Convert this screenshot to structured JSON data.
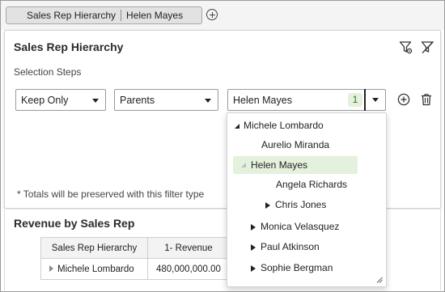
{
  "chip": {
    "hierarchy": "Sales Rep Hierarchy",
    "member": "Helen Mayes"
  },
  "panel": {
    "title": "Sales Rep Hierarchy",
    "steps_label": "Selection Steps",
    "action": "Keep Only",
    "relation": "Parents",
    "member": "Helen Mayes",
    "member_count": "1",
    "note": "* Totals will be preserved with this filter type"
  },
  "report": {
    "title": "Revenue by Sales Rep",
    "columns": [
      "Sales Rep Hierarchy",
      "1- Revenue"
    ],
    "rows": [
      {
        "rep": "Michele Lombardo",
        "revenue": "480,000,000.00"
      }
    ]
  },
  "tree": [
    {
      "label": "Michele Lombardo",
      "level": 0,
      "toggle": "expanded"
    },
    {
      "label": "Aurelio Miranda",
      "level": 1,
      "toggle": "none"
    },
    {
      "label": "Helen Mayes",
      "level": 1,
      "toggle": "expanded-light",
      "selected": true
    },
    {
      "label": "Angela Richards",
      "level": 2,
      "toggle": "none"
    },
    {
      "label": "Chris Jones",
      "level": 2,
      "toggle": "collapsed"
    },
    {
      "label": "Monica Velasquez",
      "level": 1,
      "toggle": "collapsed"
    },
    {
      "label": "Paul Atkinson",
      "level": 1,
      "toggle": "collapsed"
    },
    {
      "label": "Sophie Bergman",
      "level": 1,
      "toggle": "collapsed"
    }
  ],
  "colors": {
    "selected_bg": "#e3f1dd",
    "badge_text": "#3a6b2a",
    "border": "#9a9a9a"
  },
  "icons": {
    "add": "plus-circle-icon",
    "delete": "trash-icon",
    "filter_settings": "filter-settings-icon",
    "clear_filter": "filter-clear-icon"
  }
}
